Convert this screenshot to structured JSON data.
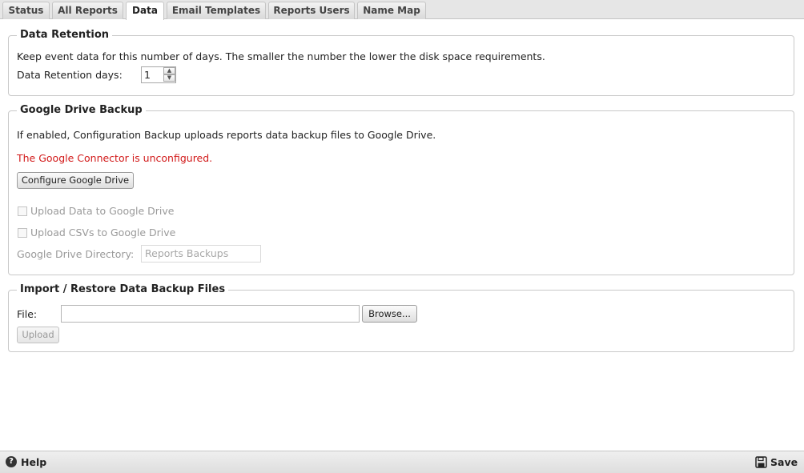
{
  "tabs": [
    {
      "label": "Status"
    },
    {
      "label": "All Reports"
    },
    {
      "label": "Data",
      "active": true
    },
    {
      "label": "Email Templates"
    },
    {
      "label": "Reports Users"
    },
    {
      "label": "Name Map"
    }
  ],
  "retention": {
    "legend": "Data Retention",
    "description": "Keep event data for this number of days. The smaller the number the lower the disk space requirements.",
    "days_label": "Data Retention days:",
    "days_value": "1"
  },
  "google_drive": {
    "legend": "Google Drive Backup",
    "description": "If enabled, Configuration Backup uploads reports data backup files to Google Drive.",
    "error": "The Google Connector is unconfigured.",
    "configure_button": "Configure Google Drive",
    "upload_data_label": "Upload Data to Google Drive",
    "upload_csvs_label": "Upload CSVs to Google Drive",
    "directory_label": "Google Drive Directory:",
    "directory_value": "Reports Backups",
    "error_color": "#d21a1a"
  },
  "import": {
    "legend": "Import / Restore Data Backup Files",
    "file_label": "File:",
    "browse_button": "Browse...",
    "upload_button": "Upload"
  },
  "footer": {
    "help": "Help",
    "save": "Save"
  }
}
